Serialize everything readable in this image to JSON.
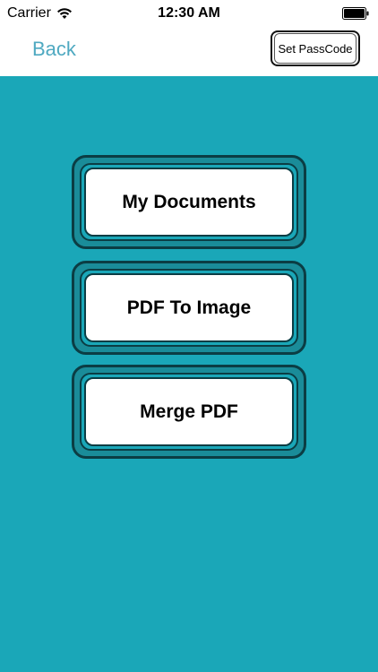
{
  "status_bar": {
    "carrier": "Carrier",
    "time": "12:30 AM"
  },
  "nav": {
    "back_label": "Back",
    "passcode_label": "Set PassCode"
  },
  "menu": {
    "items": [
      {
        "label": "My Documents"
      },
      {
        "label": "PDF To Image"
      },
      {
        "label": "Merge PDF"
      }
    ]
  },
  "colors": {
    "accent": "#4fa9c1",
    "background": "#1aa7b8",
    "border": "#0b3d44"
  },
  "icons": {
    "wifi": "wifi-icon",
    "battery": "battery-icon"
  }
}
